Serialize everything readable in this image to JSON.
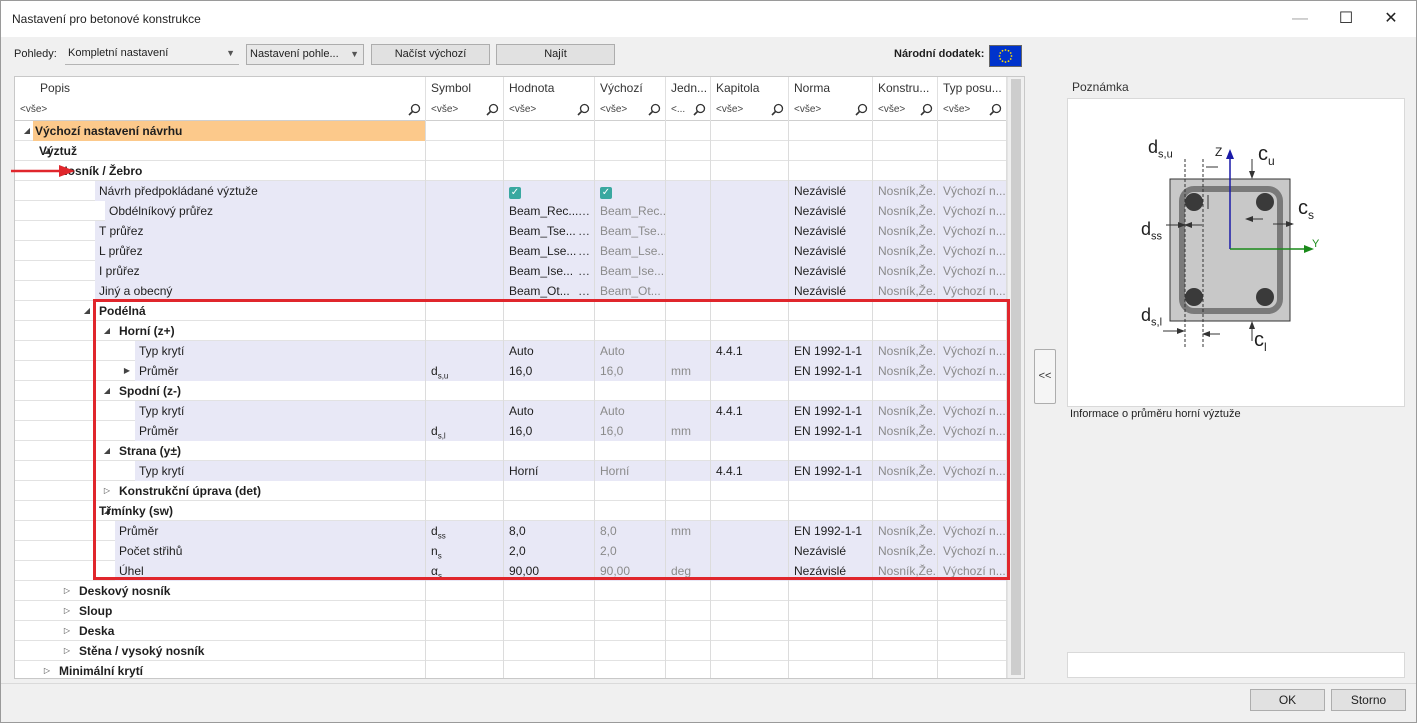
{
  "window": {
    "title": "Nastavení pro betonové konstrukce",
    "minimize": "—",
    "maximize": "☐",
    "close": "✕"
  },
  "toolbar": {
    "views_label": "Pohledy:",
    "views_value": "Kompletní nastavení",
    "view_settings": "Nastavení pohle...",
    "load_default": "Načíst výchozí",
    "find": "Najít",
    "national_annex_label": "Národní dodatek:"
  },
  "columns": [
    "Popis",
    "Symbol",
    "Hodnota",
    "Výchozí",
    "Jedn...",
    "Kapitola",
    "Norma",
    "Konstru...",
    "Typ posu..."
  ],
  "filters": [
    "<vše>",
    "<vše>",
    "<vše>",
    "<vše>",
    "<...",
    "<vše>",
    "<vše>",
    "<vše>",
    "<vše>"
  ],
  "rows": [
    {
      "label": "Výchozí nastavení návrhu",
      "expander": "◢",
      "bold": true,
      "cells": [
        "",
        "",
        "",
        "",
        "",
        "",
        "",
        ""
      ]
    },
    {
      "label": "Výztuž",
      "expander": "◢",
      "bold": true,
      "cells": [
        "",
        "",
        "",
        "",
        "",
        "",
        "",
        ""
      ]
    },
    {
      "label": "Nosník / Žebro",
      "expander": "",
      "bold": true,
      "cells": [
        "",
        "",
        "",
        "",
        "",
        "",
        "",
        ""
      ]
    },
    {
      "label": "Návrh předpokládané výztuže",
      "expander": "",
      "bold": false,
      "cells": [
        "",
        "✓",
        "✓",
        "",
        "",
        "Nezávislé",
        "Nosník,Že...",
        "Výchozí n..."
      ]
    },
    {
      "label": "Obdélníkový průřez",
      "expander": "",
      "bold": false,
      "cells": [
        "",
        "Beam_Rec...",
        "Beam_Rec...",
        "",
        "",
        "Nezávislé",
        "Nosník,Že...",
        "Výchozí n..."
      ]
    },
    {
      "label": "T průřez",
      "expander": "",
      "bold": false,
      "cells": [
        "",
        "Beam_Tse...",
        "Beam_Tse...",
        "",
        "",
        "Nezávislé",
        "Nosník,Že...",
        "Výchozí n..."
      ]
    },
    {
      "label": "L průřez",
      "expander": "",
      "bold": false,
      "cells": [
        "",
        "Beam_Lse...",
        "Beam_Lse...",
        "",
        "",
        "Nezávislé",
        "Nosník,Že...",
        "Výchozí n..."
      ]
    },
    {
      "label": "I průřez",
      "expander": "",
      "bold": false,
      "cells": [
        "",
        "Beam_Ise...",
        "Beam_Ise...",
        "",
        "",
        "Nezávislé",
        "Nosník,Že...",
        "Výchozí n..."
      ]
    },
    {
      "label": "Jiný a obecný",
      "expander": "",
      "bold": false,
      "cells": [
        "",
        "Beam_Ot...",
        "Beam_Ot...",
        "",
        "",
        "Nezávislé",
        "Nosník,Že...",
        "Výchozí n..."
      ]
    },
    {
      "label": "Podélná",
      "expander": "◢",
      "bold": true,
      "cells": [
        "",
        "",
        "",
        "",
        "",
        "",
        "",
        ""
      ]
    },
    {
      "label": "Horní (z+)",
      "expander": "◢",
      "bold": true,
      "cells": [
        "",
        "",
        "",
        "",
        "",
        "",
        "",
        ""
      ]
    },
    {
      "label": "Typ krytí",
      "expander": "",
      "bold": false,
      "cells": [
        "",
        "Auto",
        "Auto",
        "",
        "4.4.1",
        "EN 1992-1-1",
        "Nosník,Že...",
        "Výchozí n..."
      ]
    },
    {
      "label": "Průměr",
      "expander": "▶",
      "bold": false,
      "cells": [
        "d",
        "16,0",
        "16,0",
        "mm",
        "",
        "EN 1992-1-1",
        "Nosník,Že...",
        "Výchozí n..."
      ],
      "sub": "s,u"
    },
    {
      "label": "Spodní (z-)",
      "expander": "◢",
      "bold": true,
      "cells": [
        "",
        "",
        "",
        "",
        "",
        "",
        "",
        ""
      ]
    },
    {
      "label": "Typ krytí",
      "expander": "",
      "bold": false,
      "cells": [
        "",
        "Auto",
        "Auto",
        "",
        "4.4.1",
        "EN 1992-1-1",
        "Nosník,Že...",
        "Výchozí n..."
      ]
    },
    {
      "label": "Průměr",
      "expander": "",
      "bold": false,
      "cells": [
        "d",
        "16,0",
        "16,0",
        "mm",
        "",
        "EN 1992-1-1",
        "Nosník,Že...",
        "Výchozí n..."
      ],
      "sub": "s,l"
    },
    {
      "label": "Strana (y±)",
      "expander": "◢",
      "bold": true,
      "cells": [
        "",
        "",
        "",
        "",
        "",
        "",
        "",
        ""
      ]
    },
    {
      "label": "Typ krytí",
      "expander": "",
      "bold": false,
      "cells": [
        "",
        "Horní",
        "Horní",
        "",
        "4.4.1",
        "EN 1992-1-1",
        "Nosník,Že...",
        "Výchozí n..."
      ]
    },
    {
      "label": "Konstrukční úprava (det)",
      "expander": "▷",
      "bold": true,
      "cells": [
        "",
        "",
        "",
        "",
        "",
        "",
        "",
        ""
      ]
    },
    {
      "label": "Třmínky (sw)",
      "expander": "◢",
      "bold": true,
      "cells": [
        "",
        "",
        "",
        "",
        "",
        "",
        "",
        ""
      ]
    },
    {
      "label": "Průměr",
      "expander": "",
      "bold": false,
      "cells": [
        "d",
        "8,0",
        "8,0",
        "mm",
        "",
        "EN 1992-1-1",
        "Nosník,Že...",
        "Výchozí n..."
      ],
      "sub": "ss"
    },
    {
      "label": "Počet střihů",
      "expander": "",
      "bold": false,
      "cells": [
        "n",
        "2,0",
        "2,0",
        "",
        "",
        "Nezávislé",
        "Nosník,Že...",
        "Výchozí n..."
      ],
      "sub": "s"
    },
    {
      "label": "Úhel",
      "expander": "",
      "bold": false,
      "cells": [
        "α",
        "90,00",
        "90,00",
        "deg",
        "",
        "Nezávislé",
        "Nosník,Že...",
        "Výchozí n..."
      ],
      "sub": "s"
    },
    {
      "label": "Deskový nosník",
      "expander": "▷",
      "bold": true,
      "cells": [
        "",
        "",
        "",
        "",
        "",
        "",
        "",
        ""
      ]
    },
    {
      "label": "Sloup",
      "expander": "▷",
      "bold": true,
      "cells": [
        "",
        "",
        "",
        "",
        "",
        "",
        "",
        ""
      ]
    },
    {
      "label": "Deska",
      "expander": "▷",
      "bold": true,
      "cells": [
        "",
        "",
        "",
        "",
        "",
        "",
        "",
        ""
      ]
    },
    {
      "label": "Stěna / vysoký nosník",
      "expander": "▷",
      "bold": true,
      "cells": [
        "",
        "",
        "",
        "",
        "",
        "",
        "",
        ""
      ]
    },
    {
      "label": "Minimální krytí",
      "expander": "▷",
      "bold": true,
      "cells": [
        "",
        "",
        "",
        "",
        "",
        "",
        "",
        ""
      ]
    }
  ],
  "note": {
    "title": "Poznámka",
    "info": "Informace o průměru horní výztuže",
    "diagram_labels": {
      "dsu": "d",
      "dsu_sub": "s,u",
      "cu": "c",
      "cu_sub": "u",
      "cs": "c",
      "cs_sub": "s",
      "dss": "d",
      "dss_sub": "ss",
      "dsl": "d",
      "dsl_sub": "s,l",
      "cl": "c",
      "cl_sub": "l",
      "z": "Z",
      "y": "Y"
    }
  },
  "collapse_button": "<<",
  "footer": {
    "ok": "OK",
    "cancel": "Storno"
  }
}
